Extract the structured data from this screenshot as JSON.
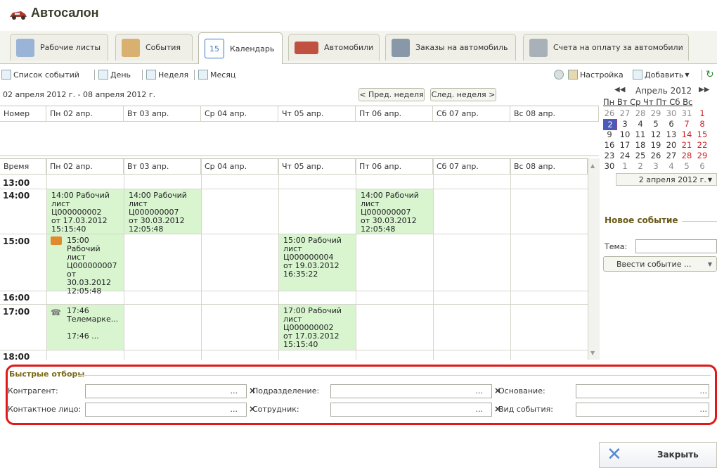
{
  "app": {
    "title": "Автосалон"
  },
  "tabs": [
    {
      "label": "Рабочие листы",
      "color": "#6a8cc8"
    },
    {
      "label": "События",
      "color": "#c8a050"
    },
    {
      "label": "Календарь",
      "color": "#3a78c0"
    },
    {
      "label": "Автомобили",
      "color": "#b04030"
    },
    {
      "label": "Заказы на автомобиль",
      "color": "#607080"
    },
    {
      "label": "Счета на оплату за автомобили",
      "color": "#889098"
    }
  ],
  "toolbar": {
    "event_list": "Список событий",
    "day": "День",
    "week": "Неделя",
    "month": "Месяц",
    "settings": "Настройка",
    "add": "Добавить"
  },
  "calendar": {
    "range": "02 апреля 2012 г. - 08 апреля 2012 г.",
    "prev_week": "< Пред. неделя",
    "next_week": "След. неделя >",
    "col_number": "Номер",
    "col_time": "Время",
    "days": [
      "Пн 02 апр.",
      "Вт 03 апр.",
      "Ср 04 апр.",
      "Чт 05 апр.",
      "Пт 06 апр.",
      "Сб 07 апр.",
      "Вс 08 апр."
    ],
    "times": [
      "13:00",
      "14:00",
      "15:00",
      "16:00",
      "17:00",
      "18:00"
    ],
    "events": {
      "mon_14": "14:00 Рабочий\nлист Ц000000002\nот 17.03.2012\n15:15:40",
      "tue_14": "14:00 Рабочий\nлист Ц000000007\nот 30.03.2012\n12:05:48",
      "fri_14": "14:00 Рабочий\nлист Ц000000007\nот 30.03.2012\n12:05:48",
      "mon_15": "15:00\nРабочий лист\nЦ000000007\nот 30.03.2012\n12:05:48",
      "thu_15": "15:00 Рабочий\nлист Ц000000004\nот 19.03.2012\n16:35:22",
      "mon_17": "17:46\nТелемарке...\n\n17:46 ...",
      "thu_17": "17:00 Рабочий\nлист Ц000000002\nот 17.03.2012\n15:15:40"
    }
  },
  "minical": {
    "month": "Апрель 2012",
    "weekdays": "Пн Вт Ср Чт Пт Сб Вс",
    "rows": [
      [
        "26",
        "27",
        "28",
        "29",
        "30",
        "31",
        "1"
      ],
      [
        "2",
        "3",
        "4",
        "5",
        "6",
        "7",
        "8"
      ],
      [
        "9",
        "10",
        "11",
        "12",
        "13",
        "14",
        "15"
      ],
      [
        "16",
        "17",
        "18",
        "19",
        "20",
        "21",
        "22"
      ],
      [
        "23",
        "24",
        "25",
        "26",
        "27",
        "28",
        "29"
      ],
      [
        "30",
        "1",
        "2",
        "3",
        "4",
        "5",
        "6"
      ]
    ],
    "selected": "2 апреля 2012 г.",
    "weekend_color": "#d02020",
    "other_month_color": "#8a8a8a"
  },
  "new_event": {
    "title": "Новое событие",
    "topic_label": "Тема:",
    "enter_button": "Ввести событие ..."
  },
  "filters": {
    "title": "Быстрые отборы",
    "counterparty": "Контрагент:",
    "department": "Подразделение:",
    "basis": "Основание:",
    "contact": "Контактное лицо:",
    "employee": "Сотрудник:",
    "event_type": "Вид события:"
  },
  "close": {
    "label": "Закрыть"
  }
}
